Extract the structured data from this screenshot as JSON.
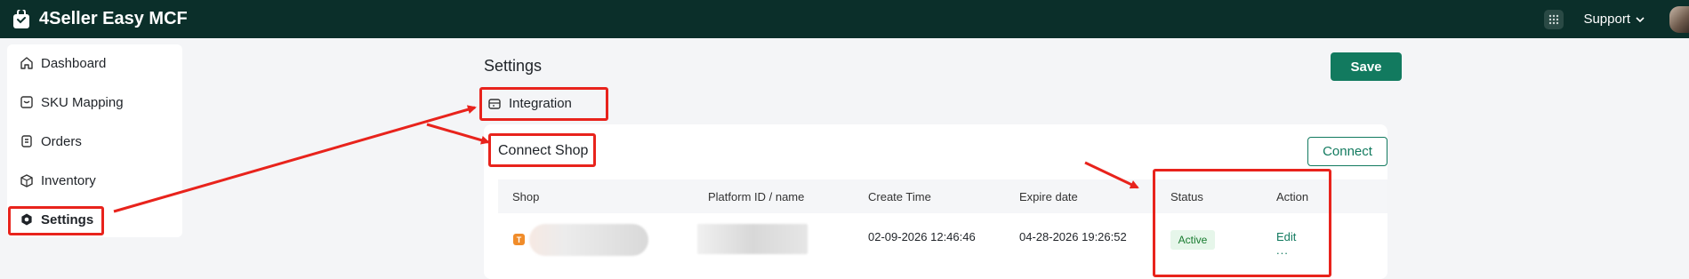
{
  "app": {
    "title": "4Seller Easy MCF"
  },
  "header": {
    "support_label": "Support"
  },
  "sidebar": {
    "items": [
      {
        "label": "Dashboard",
        "icon": "home-icon"
      },
      {
        "label": "SKU Mapping",
        "icon": "sku-mapping-icon"
      },
      {
        "label": "Orders",
        "icon": "orders-icon"
      },
      {
        "label": "Inventory",
        "icon": "inventory-icon"
      },
      {
        "label": "Settings",
        "icon": "settings-icon",
        "active": true
      }
    ]
  },
  "main": {
    "title": "Settings",
    "save_label": "Save",
    "tab": {
      "label": "Integration",
      "icon": "integration-icon"
    },
    "panel": {
      "title": "Connect Shop",
      "connect_label": "Connect",
      "columns": [
        "Shop",
        "Platform ID / name",
        "Create Time",
        "Expire date",
        "Status",
        "Action"
      ],
      "rows": [
        {
          "platform_badge": "T",
          "create_time": "02-09-2026 12:46:46",
          "expire_date": "04-28-2026 19:26:52",
          "status": "Active",
          "edit_label": "Edit",
          "more_label": "..."
        }
      ]
    }
  },
  "colors": {
    "topbar": "#0b2f2a",
    "accent": "#127a5f",
    "highlight": "#e8231c",
    "status_bg": "#e6f6ea"
  }
}
